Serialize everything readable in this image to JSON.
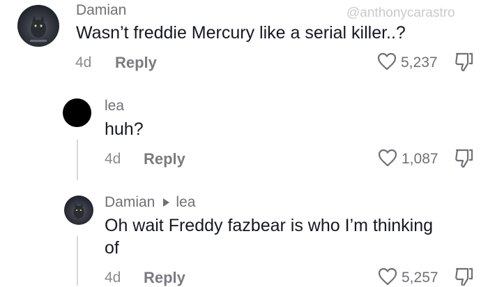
{
  "watermark": "@anthonycarastro",
  "comments": [
    {
      "username": "Damian",
      "text": "Wasn’t freddie Mercury like a serial killer..?",
      "age": "4d",
      "reply_label": "Reply",
      "likes": "5,237",
      "avatar": "cat-avatar"
    },
    {
      "username": "lea",
      "text": "huh?",
      "age": "4d",
      "reply_label": "Reply",
      "likes": "1,087",
      "avatar": "black-avatar"
    },
    {
      "username": "Damian",
      "reply_to": "lea",
      "text_line1": "Oh wait Freddy fazbear is who I’m thinking",
      "text_line2": "of",
      "age": "4d",
      "reply_label": "Reply",
      "likes": "5,257",
      "avatar": "cat-avatar"
    }
  ],
  "icons": {
    "like": "heart-outline-icon",
    "dislike": "thumbs-down-icon",
    "reply_arrow": "triangle-right-icon"
  }
}
